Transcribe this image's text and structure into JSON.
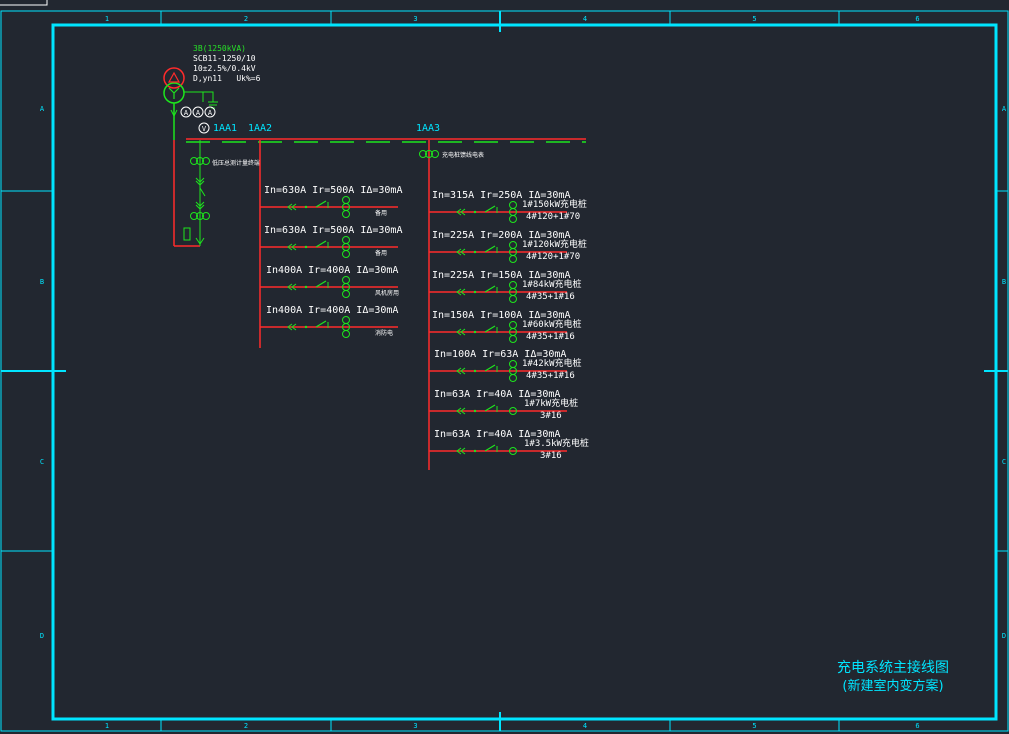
{
  "colors": {
    "background": "#222730",
    "frame": "#00e5ff",
    "busbar": "#ff2b2b",
    "device": "#1de51d",
    "text": "#ffffff",
    "label_cyan": "#00e5ff",
    "label_green": "#27e027"
  },
  "frame": {
    "columns": [
      "1",
      "2",
      "3",
      "4",
      "5",
      "6"
    ],
    "rows": [
      "A",
      "B",
      "C",
      "D"
    ]
  },
  "transformer": {
    "name": "3B(1250kVA)",
    "model": "SCB11-1250/10",
    "ratio": "10±2.5%/0.4kV",
    "vector": "D,yn11   Uk%=6"
  },
  "panels": {
    "aa1": "1AA1",
    "aa2": "1AA2",
    "aa3": "1AA3"
  },
  "incoming": {
    "ct_label": "低压总测计量终端"
  },
  "aa3_header": "充电桩馈线电表",
  "feeders_aa2": [
    {
      "rating": "In=630A Ir=500A IΔ=30mA",
      "load": "备用"
    },
    {
      "rating": "In=630A Ir=500A IΔ=30mA",
      "load": "备用"
    },
    {
      "rating": "In400A Ir=400A IΔ=30mA",
      "load": "风机房用"
    },
    {
      "rating": "In400A Ir=400A IΔ=30mA",
      "load": "消防电"
    }
  ],
  "feeders_aa3": [
    {
      "rating": "In=315A Ir=250A IΔ=30mA",
      "load": "1#150kW充电桩",
      "cable": "4#120+1#70"
    },
    {
      "rating": "In=225A Ir=200A IΔ=30mA",
      "load": "1#120kW充电桩",
      "cable": "4#120+1#70"
    },
    {
      "rating": "In=225A Ir=150A IΔ=30mA",
      "load": "1#84kW充电桩",
      "cable": "4#35+1#16"
    },
    {
      "rating": "In=150A Ir=100A IΔ=30mA",
      "load": "1#60kW充电桩",
      "cable": "4#35+1#16"
    },
    {
      "rating": "In=100A Ir=63A IΔ=30mA",
      "load": "1#42kW充电桩",
      "cable": "4#35+1#16"
    },
    {
      "rating": "In=63A Ir=40A IΔ=30mA",
      "load": "1#7kW充电桩",
      "cable": "3#16"
    },
    {
      "rating": "In=63A Ir=40A IΔ=30mA",
      "load": "1#3.5kW充电桩",
      "cable": "3#16"
    }
  ],
  "title_block": {
    "line1": "充电系统主接线图",
    "line2": "(新建室内变方案)"
  }
}
